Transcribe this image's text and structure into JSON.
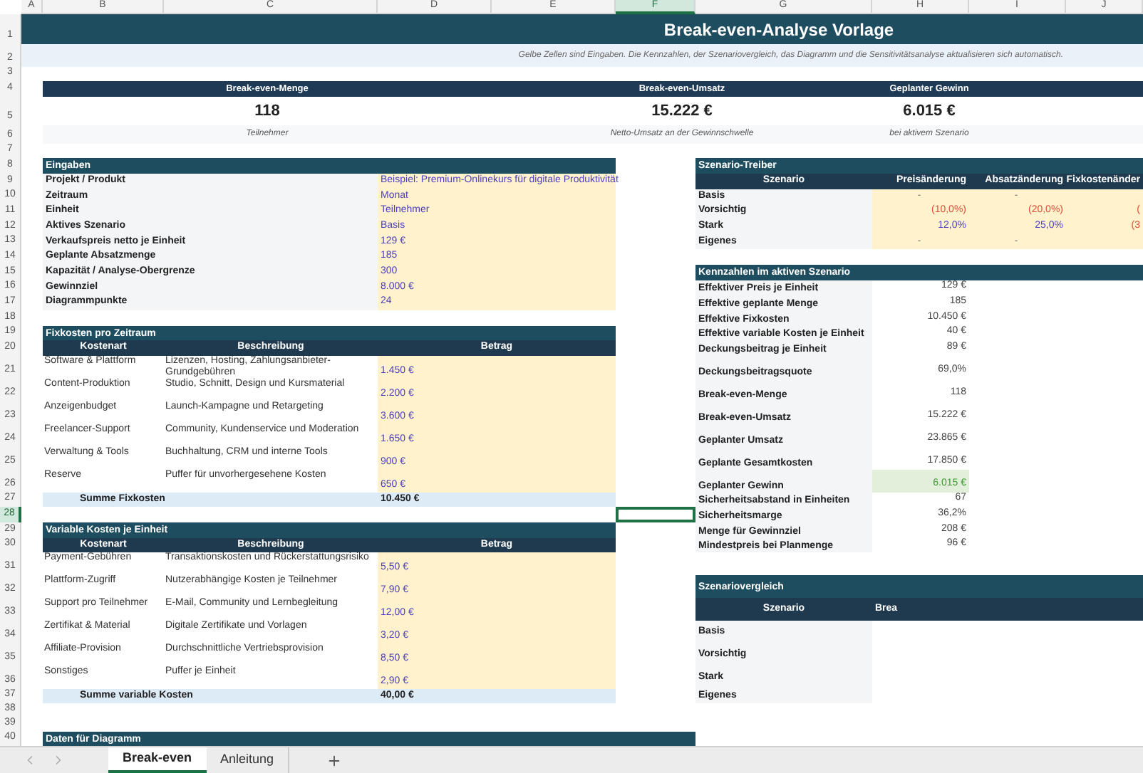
{
  "column_headers": [
    {
      "label": "A",
      "selected": false
    },
    {
      "label": "B",
      "selected": false
    },
    {
      "label": "C",
      "selected": false
    },
    {
      "label": "D",
      "selected": false
    },
    {
      "label": "E",
      "selected": false
    },
    {
      "label": "F",
      "selected": true
    },
    {
      "label": "G",
      "selected": false
    },
    {
      "label": "H",
      "selected": false
    },
    {
      "label": "I",
      "selected": false
    },
    {
      "label": "J",
      "selected": false
    }
  ],
  "row_numbers": [
    {
      "label": "1",
      "selected": false
    },
    {
      "label": "2",
      "selected": false
    },
    {
      "label": "3",
      "selected": false
    },
    {
      "label": "4",
      "selected": false
    },
    {
      "label": "5",
      "selected": false
    },
    {
      "label": "6",
      "selected": false
    },
    {
      "label": "7",
      "selected": false
    },
    {
      "label": "8",
      "selected": false
    },
    {
      "label": "9",
      "selected": false
    },
    {
      "label": "10",
      "selected": false
    },
    {
      "label": "11",
      "selected": false
    },
    {
      "label": "12",
      "selected": false
    },
    {
      "label": "13",
      "selected": false
    },
    {
      "label": "14",
      "selected": false
    },
    {
      "label": "15",
      "selected": false
    },
    {
      "label": "16",
      "selected": false
    },
    {
      "label": "17",
      "selected": false
    },
    {
      "label": "18",
      "selected": false
    },
    {
      "label": "19",
      "selected": false
    },
    {
      "label": "20",
      "selected": false
    },
    {
      "label": "21",
      "selected": false
    },
    {
      "label": "22",
      "selected": false
    },
    {
      "label": "23",
      "selected": false
    },
    {
      "label": "24",
      "selected": false
    },
    {
      "label": "25",
      "selected": false
    },
    {
      "label": "26",
      "selected": false
    },
    {
      "label": "27",
      "selected": false
    },
    {
      "label": "28",
      "selected": true
    },
    {
      "label": "29",
      "selected": false
    },
    {
      "label": "30",
      "selected": false
    },
    {
      "label": "31",
      "selected": false
    },
    {
      "label": "32",
      "selected": false
    },
    {
      "label": "33",
      "selected": false
    },
    {
      "label": "34",
      "selected": false
    },
    {
      "label": "35",
      "selected": false
    },
    {
      "label": "36",
      "selected": false
    },
    {
      "label": "37",
      "selected": false
    },
    {
      "label": "38",
      "selected": false
    },
    {
      "label": "39",
      "selected": false
    },
    {
      "label": "40",
      "selected": false
    }
  ],
  "title": "Break-even-Analyse Vorlage",
  "subtitle": "Gelbe Zellen sind Eingaben. Die Kennzahlen, der Szenariovergleich, das Diagramm und die Sensitivitätsanalyse aktualisieren sich automatisch.",
  "kpis": [
    {
      "label": "Break-even-Menge",
      "value": "118",
      "caption": "Teilnehmer"
    },
    {
      "label": "Break-even-Umsatz",
      "value": "15.222 €",
      "caption": "Netto-Umsatz an der Gewinnschwelle"
    },
    {
      "label": "Geplanter Gewinn",
      "value": "6.015 €",
      "caption": "bei aktivem Szenario"
    }
  ],
  "inputs": {
    "title": "Eingaben",
    "rows": [
      {
        "label": "Projekt / Produkt",
        "value": "Beispiel: Premium-Onlinekurs für digitale Produktivität"
      },
      {
        "label": "Zeitraum",
        "value": "Monat"
      },
      {
        "label": "Einheit",
        "value": "Teilnehmer"
      },
      {
        "label": "Aktives Szenario",
        "value": "Basis"
      },
      {
        "label": "Verkaufspreis netto je Einheit",
        "value": "129 €"
      },
      {
        "label": "Geplante Absatzmenge",
        "value": "185"
      },
      {
        "label": "Kapazität / Analyse-Obergrenze",
        "value": "300"
      },
      {
        "label": "Gewinnziel",
        "value": "8.000 €"
      },
      {
        "label": "Diagrammpunkte",
        "value": "24"
      }
    ]
  },
  "fixed_costs": {
    "title": "Fixkosten pro Zeitraum",
    "columns": [
      "Kostenart",
      "Beschreibung",
      "Betrag"
    ],
    "rows": [
      {
        "type": "Software & Plattform",
        "description": "Lizenzen, Hosting, Zahlungsanbieter-Grundgebühren",
        "amount": "1.450 €"
      },
      {
        "type": "Content-Produktion",
        "description": "Studio, Schnitt, Design und Kursmaterial",
        "amount": "2.200 €"
      },
      {
        "type": "Anzeigenbudget",
        "description": "Launch-Kampagne und Retargeting",
        "amount": "3.600 €"
      },
      {
        "type": "Freelancer-Support",
        "description": "Community, Kundenservice und Moderation",
        "amount": "1.650 €"
      },
      {
        "type": "Verwaltung & Tools",
        "description": "Buchhaltung, CRM und interne Tools",
        "amount": "900 €"
      },
      {
        "type": "Reserve",
        "description": "Puffer für unvorhergesehene Kosten",
        "amount": "650 €"
      }
    ],
    "total_label": "Summe Fixkosten",
    "total": "10.450 €"
  },
  "variable_costs": {
    "title": "Variable Kosten je Einheit",
    "columns": [
      "Kostenart",
      "Beschreibung",
      "Betrag"
    ],
    "rows": [
      {
        "type": "Payment-Gebühren",
        "description": "Transaktionskosten und Rückerstattungsrisiko",
        "amount": "5,50 €"
      },
      {
        "type": "Plattform-Zugriff",
        "description": "Nutzerabhängige Kosten je Teilnehmer",
        "amount": "7,90 €"
      },
      {
        "type": "Support pro Teilnehmer",
        "description": "E-Mail, Community und Lernbegleitung",
        "amount": "12,00 €"
      },
      {
        "type": "Zertifikat & Material",
        "description": "Digitale Zertifikate und Vorlagen",
        "amount": "3,20 €"
      },
      {
        "type": "Affiliate-Provision",
        "description": "Durchschnittliche Vertriebsprovision",
        "amount": "8,50 €"
      },
      {
        "type": "Sonstiges",
        "description": "Puffer je Einheit",
        "amount": "2,90 €"
      }
    ],
    "total_label": "Summe variable Kosten",
    "total": "40,00 €"
  },
  "diagram_section": {
    "title": "Daten für Diagramm"
  },
  "scenario_drivers": {
    "title": "Szenario-Treiber",
    "columns": [
      "Szenario",
      "Preisänderung",
      "Absatzänderung",
      "Fixkostenänder"
    ],
    "rows": [
      {
        "name": "Basis",
        "values": [
          {
            "text": "-",
            "kind": "neutral"
          },
          {
            "text": "-",
            "kind": "neutral"
          }
        ]
      },
      {
        "name": "Vorsichtig",
        "values": [
          {
            "text": "(10,0%)",
            "kind": "negative"
          },
          {
            "text": "(20,0%)",
            "kind": "negative"
          },
          {
            "text": "(",
            "kind": "negative"
          }
        ]
      },
      {
        "name": "Stark",
        "values": [
          {
            "text": "12,0%",
            "kind": "positive"
          },
          {
            "text": "25,0%",
            "kind": "positive"
          },
          {
            "text": "(3",
            "kind": "negative"
          }
        ]
      },
      {
        "name": "Eigenes",
        "values": [
          {
            "text": "-",
            "kind": "neutral"
          },
          {
            "text": "-",
            "kind": "neutral"
          }
        ]
      }
    ]
  },
  "metrics": {
    "title": "Kennzahlen im aktiven Szenario",
    "rows": [
      {
        "label": "Effektiver Preis je Einheit",
        "value": "129 €",
        "highlighted": false
      },
      {
        "label": "Effektive geplante Menge",
        "value": "185",
        "highlighted": false
      },
      {
        "label": "Effektive Fixkosten",
        "value": "10.450 €",
        "highlighted": false
      },
      {
        "label": "Effektive variable Kosten je Einheit",
        "value": "40 €",
        "highlighted": false
      },
      {
        "label": "Deckungsbeitrag je Einheit",
        "value": "89 €",
        "highlighted": false
      },
      {
        "label": "Deckungsbeitragsquote",
        "value": "69,0%",
        "highlighted": false
      },
      {
        "label": "Break-even-Menge",
        "value": "118",
        "highlighted": false
      },
      {
        "label": "Break-even-Umsatz",
        "value": "15.222 €",
        "highlighted": false
      },
      {
        "label": "Geplanter Umsatz",
        "value": "23.865 €",
        "highlighted": false
      },
      {
        "label": "Geplante Gesamtkosten",
        "value": "17.850 €",
        "highlighted": false
      },
      {
        "label": "Geplanter Gewinn",
        "value": "6.015 €",
        "highlighted": true
      },
      {
        "label": "Sicherheitsabstand in Einheiten",
        "value": "67",
        "highlighted": false
      },
      {
        "label": "Sicherheitsmarge",
        "value": "36,2%",
        "highlighted": false
      },
      {
        "label": "Menge für Gewinnziel",
        "value": "208 €",
        "highlighted": false
      },
      {
        "label": "Mindestpreis bei Planmenge",
        "value": "96 €",
        "highlighted": false
      }
    ]
  },
  "comparison": {
    "title": "Szenariovergleich",
    "columns": [
      "Szenario",
      "Brea"
    ],
    "rows": [
      {
        "name": "Basis"
      },
      {
        "name": "Vorsichtig"
      },
      {
        "name": "Stark"
      },
      {
        "name": "Eigenes"
      }
    ]
  },
  "sheet_tabs": [
    {
      "label": "Break-even",
      "selected": true
    },
    {
      "label": "Anleitung",
      "selected": false
    }
  ]
}
